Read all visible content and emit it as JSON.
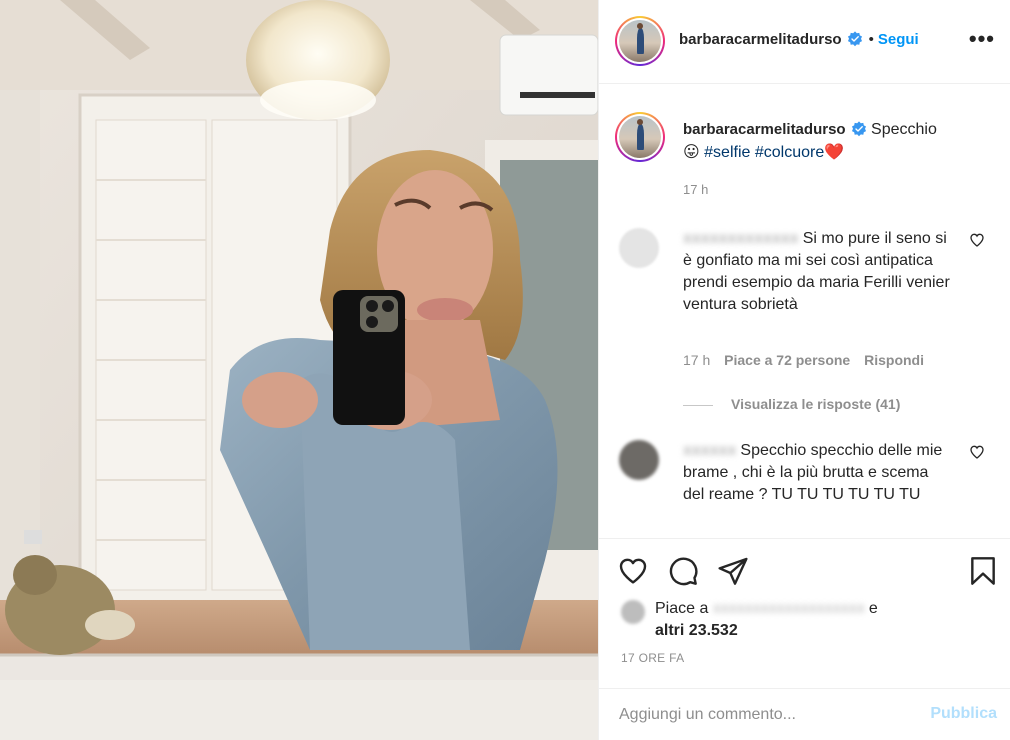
{
  "post": {
    "username": "barbaracarmelitadurso",
    "follow_label": "Segui",
    "dot_separator": "•",
    "more_label": "•••",
    "caption_text": "Specchio",
    "caption_emoji": "😛",
    "hashtag_1": "#selfie",
    "hashtag_2": "#colcuore",
    "caption_heart": "❤️",
    "caption_time": "17 h"
  },
  "comments": [
    {
      "username": "xxxxxxxxxxxxx",
      "text": "Si mo pure il seno si è gonfiato ma mi sei così antipatica prendi esempio da maria Ferilli venier ventura sobrietà",
      "time": "17 h",
      "likes": "Piace a 72 persone",
      "reply_label": "Rispondi",
      "view_replies": "Visualizza le risposte (41)"
    },
    {
      "username": "xxxxxx",
      "text": "Specchio specchio delle mie brame , chi è la più brutta e scema del reame ? TU TU TU TU TU TU"
    }
  ],
  "likes": {
    "prefix": "Piace a",
    "blurred_name": "xxxxxxxxxxxxxxxxxxx",
    "suffix": "e",
    "others": "altri 23.532"
  },
  "date_label": "17 ORE FA",
  "comment_input": {
    "placeholder": "Aggiungi un commento...",
    "publish_label": "Pubblica"
  },
  "colors": {
    "link_blue": "#0095f6",
    "hashtag": "#00376b",
    "muted": "#8e8e8e",
    "publish_disabled": "#b2dffc"
  },
  "icons": [
    "verified-badge-icon",
    "heart-outline-icon",
    "comment-icon",
    "share-icon",
    "bookmark-icon"
  ]
}
